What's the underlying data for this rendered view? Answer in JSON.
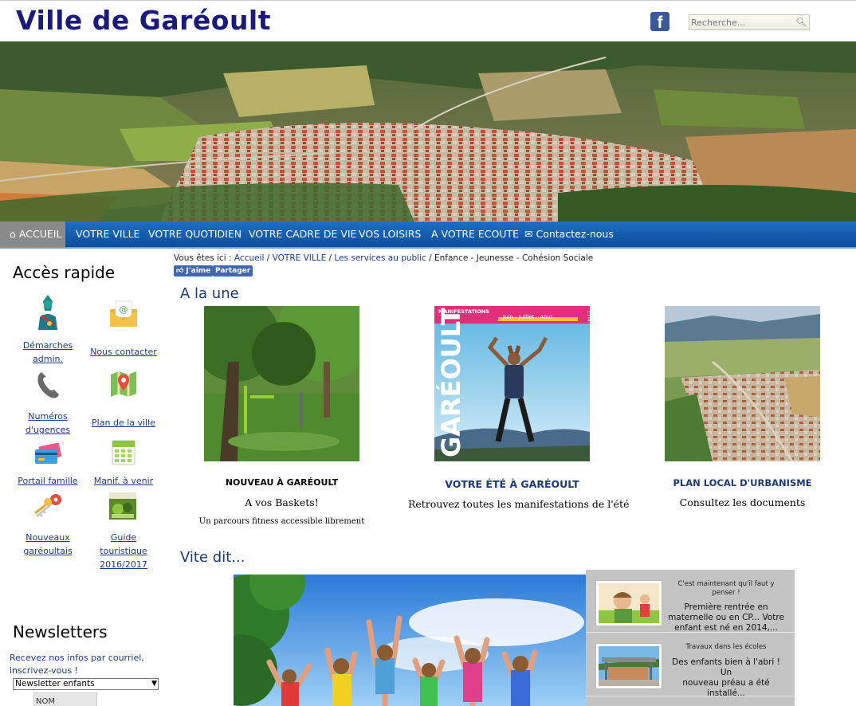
{
  "header": {
    "title": "Ville de Garéoult",
    "facebook_glyph": "f",
    "search": {
      "placeholder": "Recherche..."
    }
  },
  "nav": {
    "items": [
      {
        "label": "ACCUEIL",
        "icon": "home-icon",
        "active": true
      },
      {
        "label": "VOTRE VILLE"
      },
      {
        "label": "VOTRE QUOTIDIEN"
      },
      {
        "label": "VOTRE CADRE DE VIE"
      },
      {
        "label": "VOS LOISIRS"
      },
      {
        "label": "A VOTRE ECOUTE"
      },
      {
        "label": "Contactez-nous",
        "icon": "envelope-icon"
      }
    ]
  },
  "sidebar": {
    "quick_title": "Accès rapide",
    "items": [
      {
        "label_1": "Démarches",
        "label_2": "admin.",
        "icon": "official-bust-icon"
      },
      {
        "label_1": "Nous contacter",
        "label_2": "",
        "icon": "email-envelope-icon"
      },
      {
        "label_1": "Numéros",
        "label_2": "d'ugences",
        "icon": "phone-icon"
      },
      {
        "label_1": "Plan de la ville",
        "label_2": "",
        "icon": "map-pin-icon"
      },
      {
        "label_1": "Portail famille",
        "label_2": "",
        "icon": "payment-card-icon"
      },
      {
        "label_1": "Manif. à venir",
        "label_2": "",
        "icon": "calendar-icon"
      },
      {
        "label_1": "Nouveaux",
        "label_2": "garéoultais",
        "icon": "keys-icon"
      },
      {
        "label_1": "Guide touristique",
        "label_2": "2016/2017",
        "icon": "tourist-guide-icon"
      }
    ],
    "newsletter": {
      "title": "Newsletters",
      "text_1": "Recevez nos infos par courriel,",
      "text_2": "inscrivez-vous !",
      "select_value": "Newsletter enfants",
      "name_placeholder": "NOM"
    }
  },
  "breadcrumb": {
    "prefix": "Vous êtes ici : ",
    "items": [
      "Accueil",
      "VOTRE VILLE",
      "Les services au public",
      "Enfance - Jeunesse - Cohésion Sociale"
    ],
    "separator": " / "
  },
  "social": {
    "like_label": "J'aime",
    "share_label": "Partager"
  },
  "a_la_une": {
    "title": "A la une",
    "cards": [
      {
        "title": "NOUVEAU À GARÉOULT",
        "subtitle": "A vos Baskets!",
        "small": "Un parcours fitness accessible librement"
      },
      {
        "title": "VOTRE ÉTÉ À GARÉOULT",
        "subtitle": "Retrouvez toutes les manifestations de l'été",
        "small": "",
        "poster": {
          "top_label": "MANIFESTATIONS",
          "months": "Juin - Juillet - Aout",
          "year": "2017",
          "name": "GARÉOULT"
        }
      },
      {
        "title": "PLAN LOCAL D'URBANISME",
        "subtitle": "Consultez les documents",
        "small": ""
      }
    ]
  },
  "vite_dit": {
    "title": "Vite dit...",
    "items": [
      {
        "kicker_1": "C'est maintenant qu'il faut y",
        "kicker_2": "penser !",
        "text_1": "Première rentrée en",
        "text_2": "maternelle ou en CP... Votre",
        "text_3": "enfant est né en 2014,..."
      },
      {
        "kicker_1": "Travaux dans les écoles",
        "kicker_2": "",
        "text_1": "Des enfants bien à l'abri ! Un",
        "text_2": "nouveau préau a été installé...",
        "text_3": ""
      }
    ]
  },
  "colors": {
    "title": "#1a1a7a",
    "nav": "#1f6fc2",
    "link": "#1a3a8a",
    "facebook": "#3b5998"
  }
}
